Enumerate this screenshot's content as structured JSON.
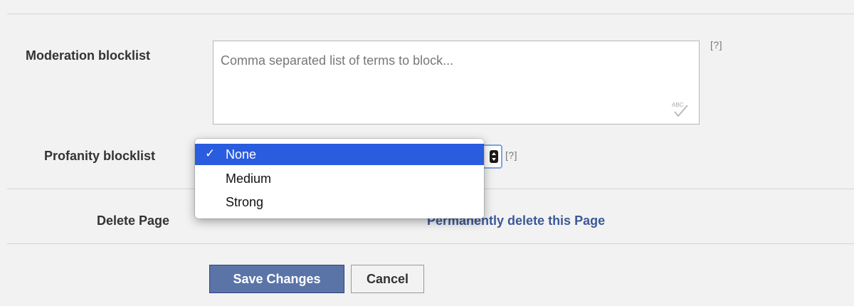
{
  "moderation": {
    "label": "Moderation blocklist",
    "placeholder": "Comma separated list of terms to block...",
    "help": "[?]"
  },
  "profanity": {
    "label": "Profanity blocklist",
    "help": "[?]",
    "options": [
      {
        "label": "None",
        "selected": true,
        "check": "✓"
      },
      {
        "label": "Medium",
        "selected": false
      },
      {
        "label": "Strong",
        "selected": false
      }
    ]
  },
  "delete_page": {
    "label": "Delete Page",
    "link": "Permanently delete this Page"
  },
  "buttons": {
    "save": "Save Changes",
    "cancel": "Cancel"
  },
  "colors": {
    "selected_option": "#2a5cdf",
    "save_button": "#5b74a8",
    "link": "#3b5998"
  }
}
